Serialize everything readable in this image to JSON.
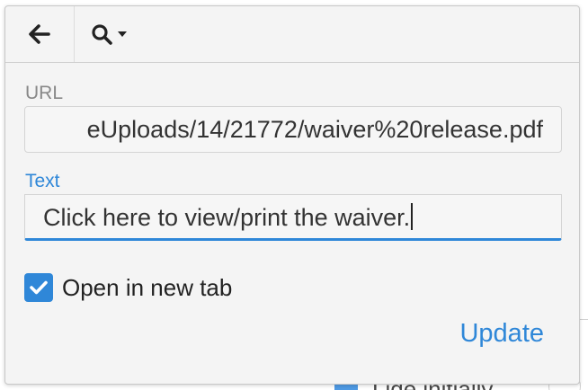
{
  "background": {
    "partial_label": "Lide initially"
  },
  "toolbar": {
    "back_icon": "arrow-left-icon",
    "search_icon": "search-icon",
    "dropdown_icon": "caret-down-icon"
  },
  "url_field": {
    "label": "URL",
    "value": "eUploads/14/21772/waiver%20release.pdf"
  },
  "text_field": {
    "label": "Text",
    "value": "Click here to view/print the waiver."
  },
  "new_tab": {
    "checked": true,
    "label": "Open in new tab"
  },
  "update_label": "Update",
  "colors": {
    "accent": "#2f87d8",
    "panel": "#f4f4f4",
    "muted_label": "#888888"
  }
}
